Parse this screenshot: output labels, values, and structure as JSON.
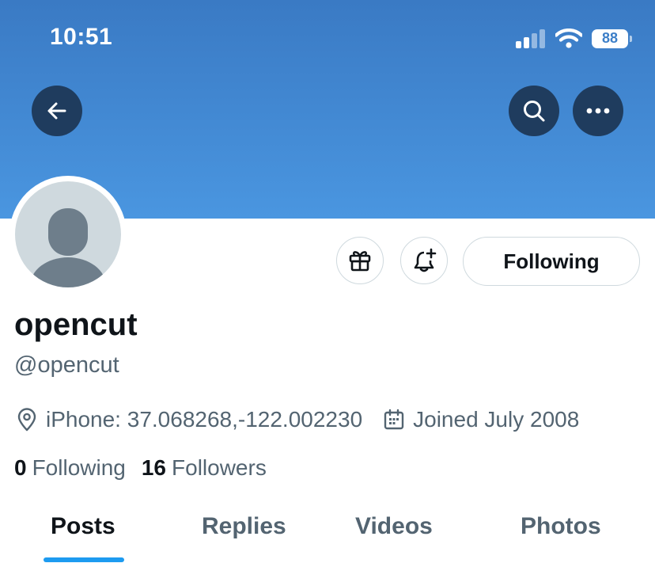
{
  "status_bar": {
    "time": "10:51",
    "battery": "88"
  },
  "profile": {
    "name": "opencut",
    "handle": "@opencut",
    "location": "iPhone: 37.068268,-122.002230",
    "joined": "Joined July 2008",
    "following_count": "0",
    "following_label": "Following",
    "followers_count": "16",
    "followers_label": "Followers"
  },
  "actions": {
    "following_button": "Following"
  },
  "tabs": [
    {
      "label": "Posts",
      "active": true
    },
    {
      "label": "Replies"
    },
    {
      "label": "Videos"
    },
    {
      "label": "Photos"
    }
  ],
  "colors": {
    "banner": "#4a96e0",
    "accent": "#1d9bf0",
    "header_button": "#1f3c5e",
    "secondary_text": "#536471"
  },
  "icons": {
    "back": "arrow-left-icon",
    "search": "search-icon",
    "more": "more-icon",
    "gift": "gift-icon",
    "notify": "bell-plus-icon",
    "location": "location-pin-icon",
    "calendar": "calendar-icon"
  }
}
